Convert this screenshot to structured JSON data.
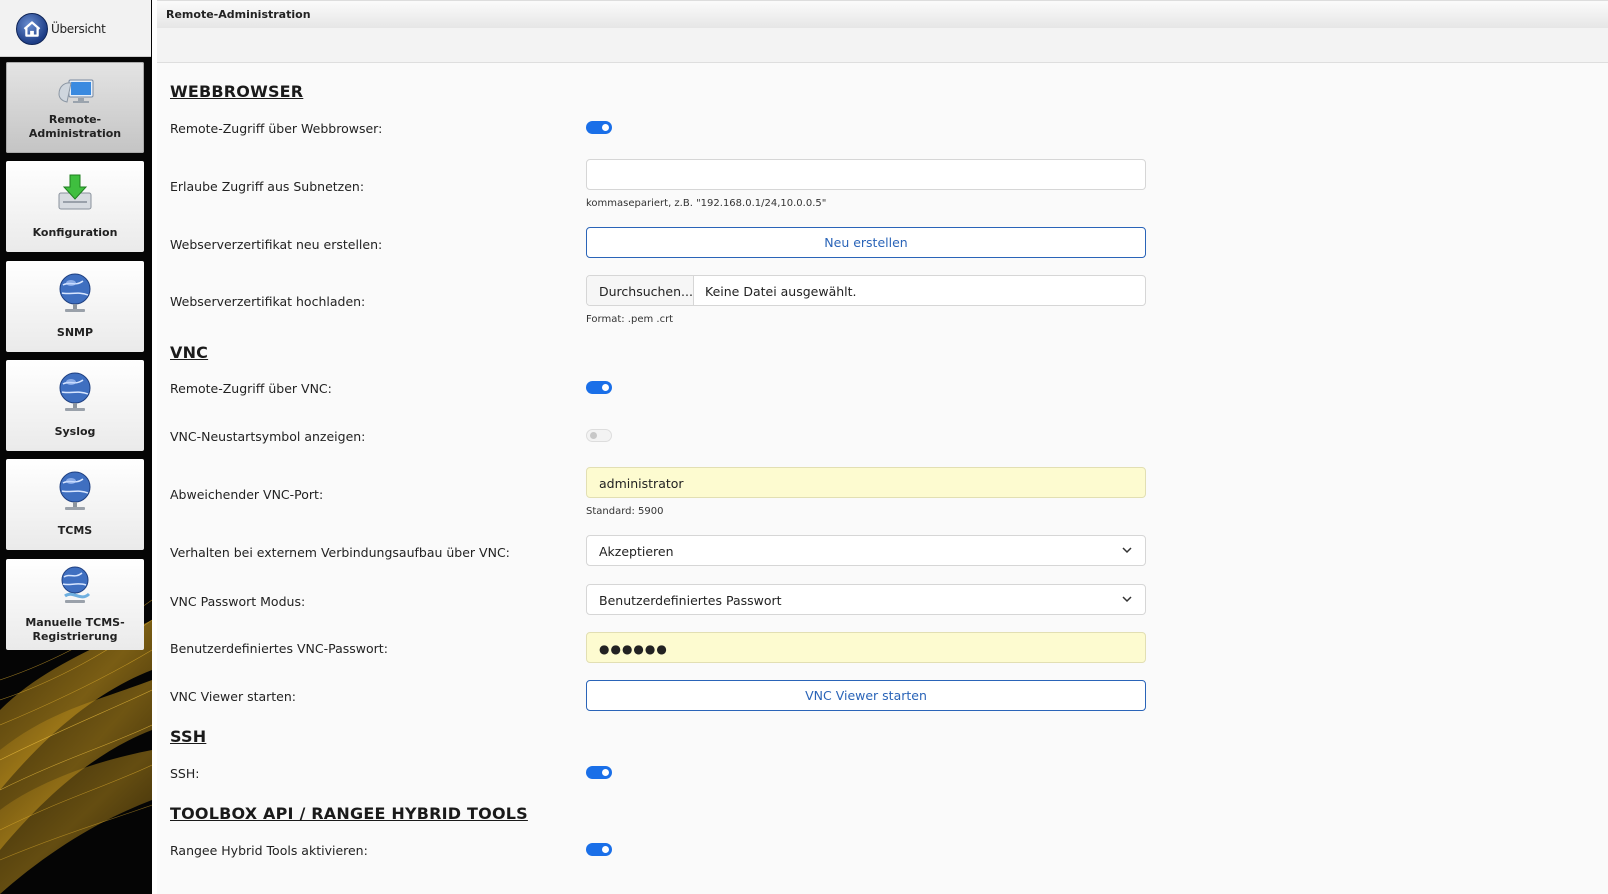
{
  "sidebar": {
    "home_label": "Übersicht",
    "items": [
      {
        "label": "Remote-Administration",
        "icon": "remote-admin-icon",
        "active": true
      },
      {
        "label": "Konfiguration",
        "icon": "config-download-icon"
      },
      {
        "label": "SNMP",
        "icon": "globe-network-icon"
      },
      {
        "label": "Syslog",
        "icon": "globe-network-icon"
      },
      {
        "label": "TCMS",
        "icon": "globe-network-icon"
      },
      {
        "label_line1": "Manuelle TCMS-",
        "label_line2": "Registrierung",
        "icon": "globe-register-icon"
      }
    ]
  },
  "header": {
    "title": "Remote-Administration"
  },
  "sections": {
    "webbrowser": {
      "heading": "WEBBROWSER",
      "remote_access_label": "Remote-Zugriff über Webbrowser:",
      "remote_access_on": true,
      "subnets_label": "Erlaube Zugriff aus Subnetzen:",
      "subnets_value": "",
      "subnets_hint": "kommasepariert, z.B. \"192.168.0.1/24,10.0.0.5\"",
      "cert_new_label": "Webserverzertifikat neu erstellen:",
      "cert_new_button": "Neu erstellen",
      "cert_upload_label": "Webserverzertifikat hochladen:",
      "browse_button": "Durchsuchen...",
      "no_file_text": "Keine Datei ausgewählt.",
      "format_hint": "Format: .pem .crt"
    },
    "vnc": {
      "heading": "VNC",
      "remote_access_label": "Remote-Zugriff über VNC:",
      "remote_access_on": true,
      "restart_icon_label": "VNC-Neustartsymbol anzeigen:",
      "restart_icon_on": false,
      "port_label": "Abweichender VNC-Port:",
      "port_value": "administrator",
      "port_hint": "Standard: 5900",
      "behavior_label": "Verhalten bei externem Verbindungsaufbau über VNC:",
      "behavior_value": "Akzeptieren",
      "password_mode_label": "VNC Passwort Modus:",
      "password_mode_value": "Benutzerdefiniertes Passwort",
      "custom_password_label": "Benutzerdefiniertes VNC-Passwort:",
      "custom_password_mask": "●●●●●●",
      "viewer_label": "VNC Viewer starten:",
      "viewer_button": "VNC Viewer starten"
    },
    "ssh": {
      "heading": "SSH",
      "ssh_label": "SSH:",
      "ssh_on": true
    },
    "toolbox": {
      "heading": "TOOLBOX API / RANGEE HYBRID TOOLS",
      "hybrid_label": "Rangee Hybrid Tools aktivieren:",
      "hybrid_on": true
    }
  },
  "colors": {
    "accent": "#1a6fe8",
    "button_border": "#2a64b8",
    "autofill_yellow": "#fdfbd0",
    "sidebar_bg": "#050505"
  }
}
